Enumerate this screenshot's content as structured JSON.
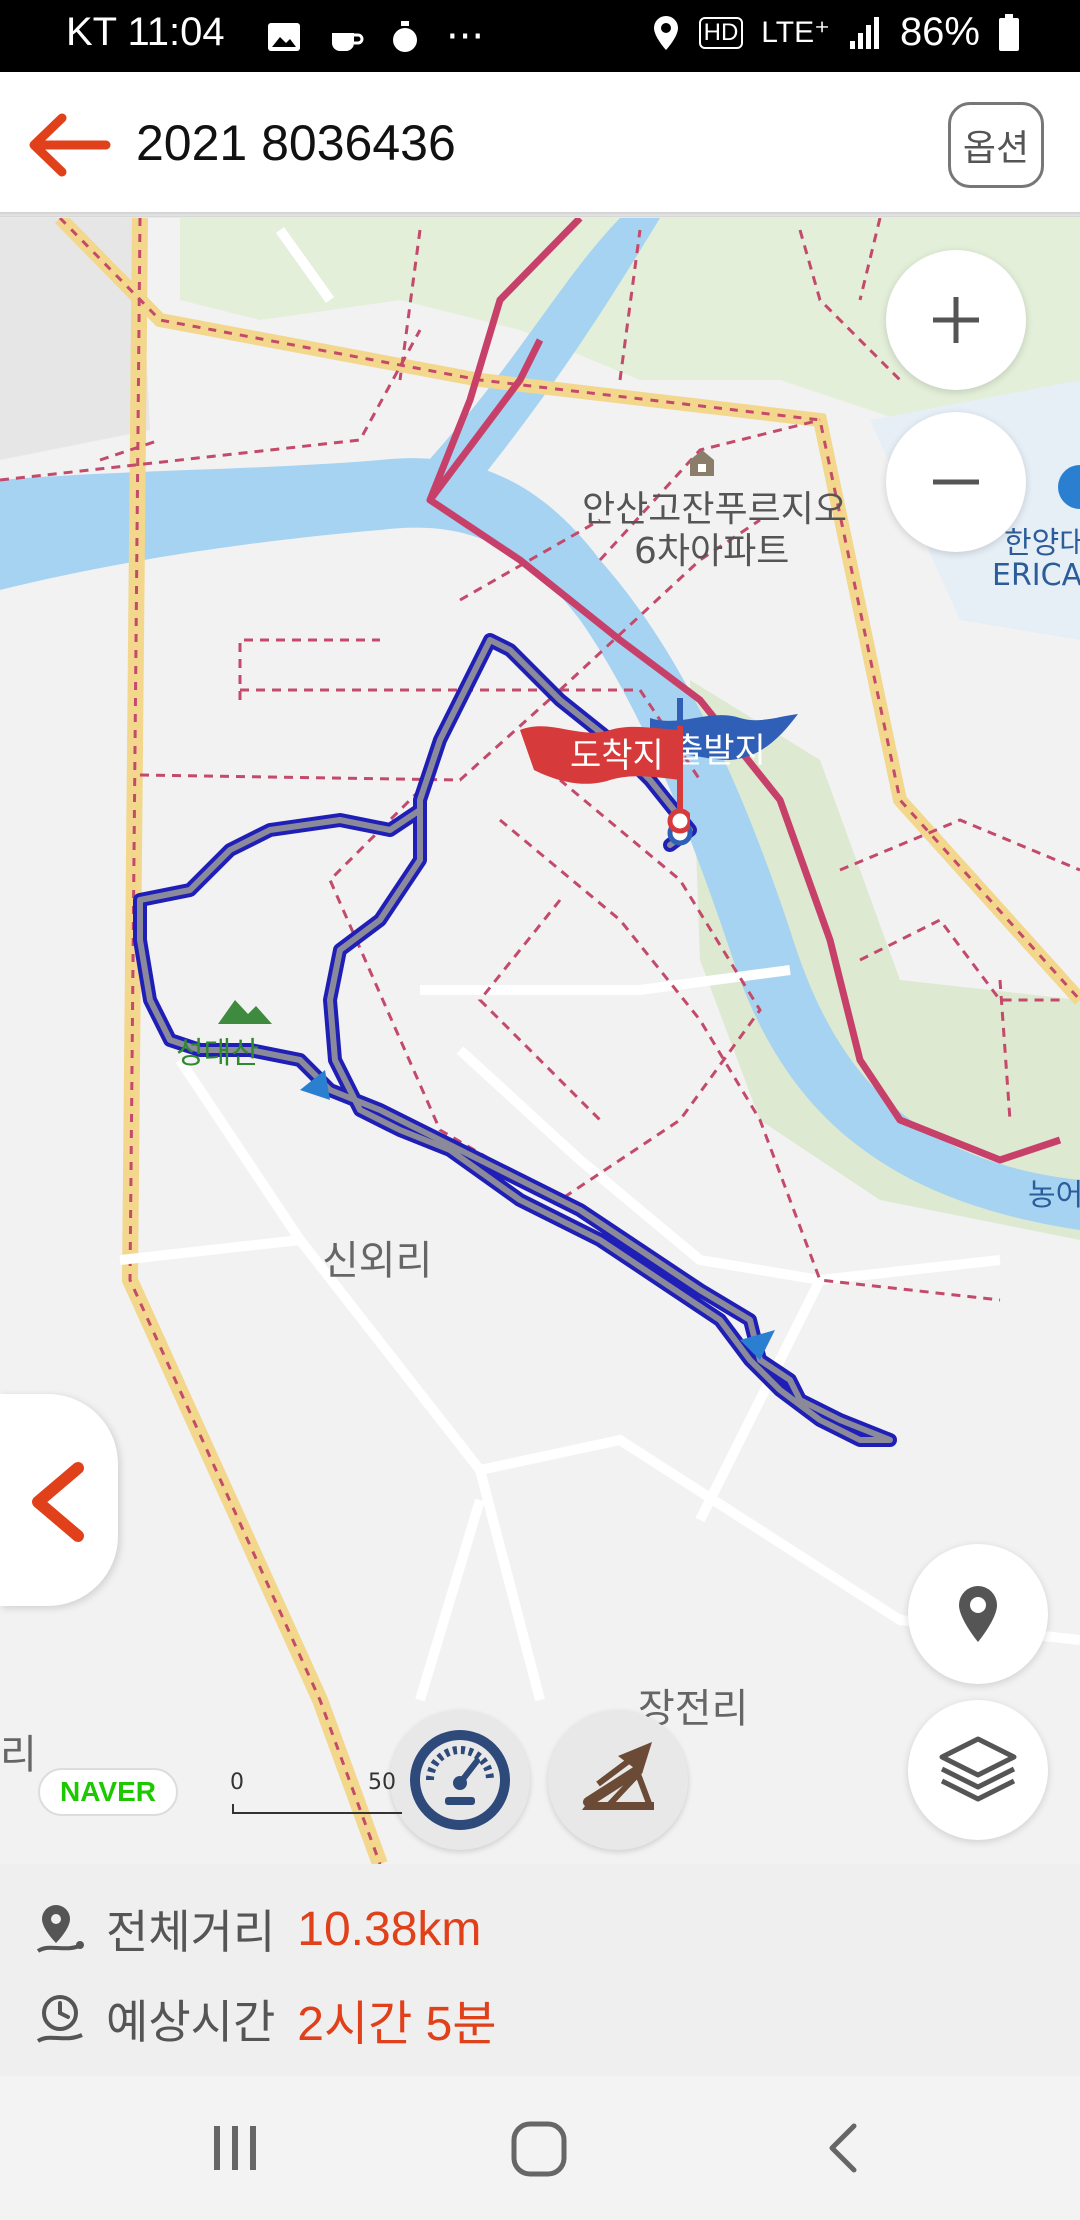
{
  "status_bar": {
    "carrier_time": "KT 11:04",
    "dots": "···",
    "hd": "HD",
    "network": "LTE⁺",
    "battery": "86%"
  },
  "app_bar": {
    "title": "2021 8036436",
    "option_label": "옵션"
  },
  "map": {
    "labels": {
      "apartment_line1": "안산고잔푸르지오",
      "apartment_line2": "6차아파트",
      "university_line1": "한양대",
      "university_line2": "ERICA",
      "village1": "신외리",
      "village2": "장전리",
      "edge_right": "농어",
      "edge_left": "리",
      "mountain": "성대산"
    },
    "flags": {
      "arrival": "도착지",
      "departure": "출발지"
    },
    "scale": {
      "start": "0",
      "end": "50"
    },
    "naver_logo": "NAVER"
  },
  "info": {
    "distance_label": "전체거리",
    "distance_value": "10.38km",
    "time_label": "예상시간",
    "time_value": "2시간 5분"
  },
  "colors": {
    "accent": "#e0401a",
    "river": "#a6d3f2",
    "route": "#1f1fb8",
    "road_highlight": "#c7406a"
  }
}
